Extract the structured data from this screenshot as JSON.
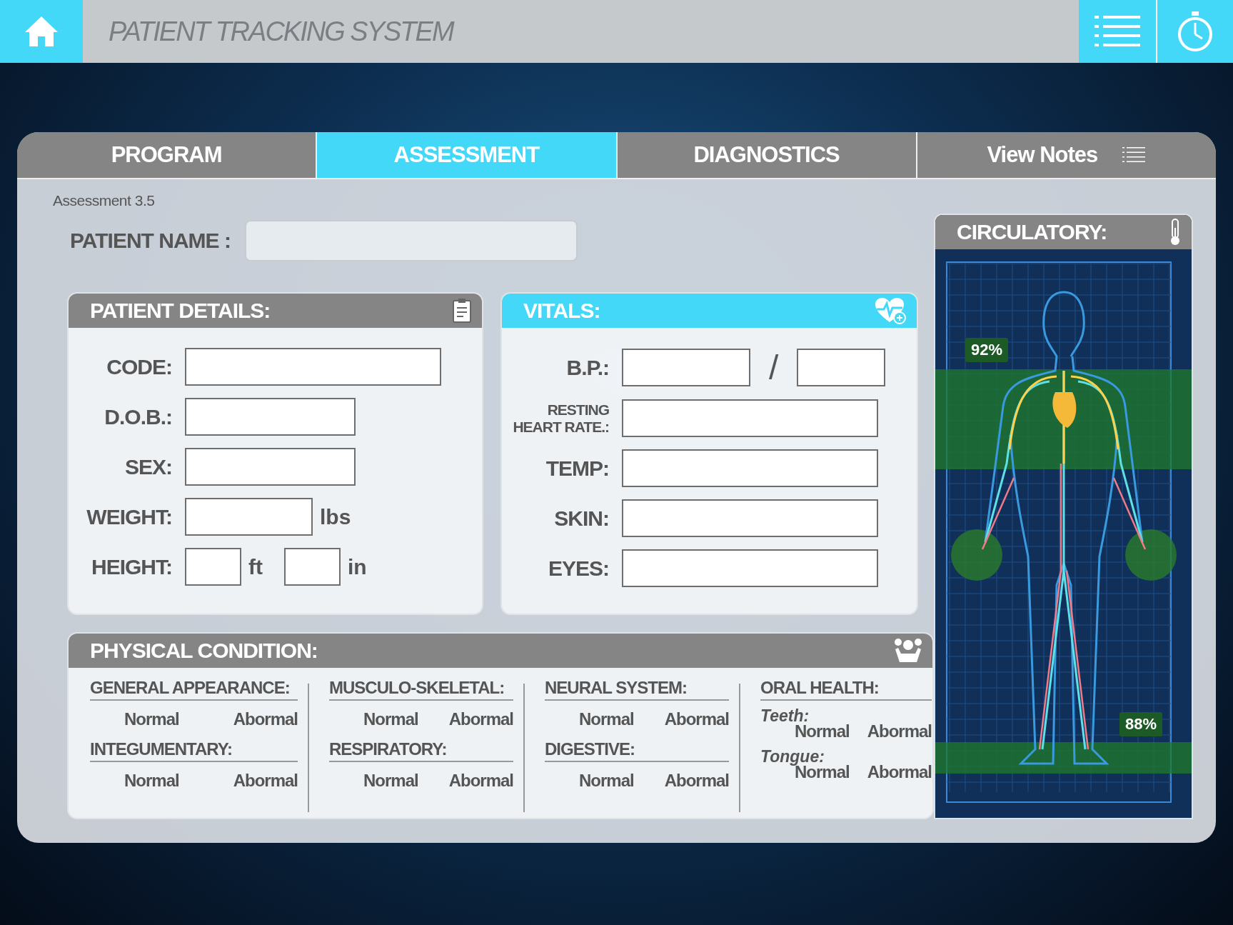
{
  "header": {
    "title": "PATIENT TRACKING SYSTEM"
  },
  "tabs": [
    {
      "label": "PROGRAM",
      "selected": false,
      "kind": "plain"
    },
    {
      "label": "ASSESSMENT",
      "selected": true,
      "kind": "plain"
    },
    {
      "label": "DIAGNOSTICS",
      "selected": false,
      "kind": "plain"
    },
    {
      "label": "View Notes",
      "selected": false,
      "kind": "notes"
    }
  ],
  "assessment_label": "Assessment 3.5",
  "patient_name": {
    "label": "PATIENT NAME :"
  },
  "patient_details": {
    "title": "PATIENT DETAILS:",
    "fields": [
      {
        "label": "CODE:",
        "kind": "long"
      },
      {
        "label": "D.O.B.:",
        "kind": "short"
      },
      {
        "label": "SEX:",
        "kind": "short"
      },
      {
        "label": "WEIGHT:",
        "kind": "unit",
        "units": [
          "lbs"
        ]
      },
      {
        "label": "HEIGHT:",
        "kind": "unit",
        "units": [
          "ft",
          "in"
        ]
      }
    ]
  },
  "vitals": {
    "title": "VITALS:",
    "fields": [
      {
        "label": "B.P.:",
        "kind": "pair",
        "separator": "/"
      },
      {
        "label": "RESTING HEART RATE.:",
        "kind": "single"
      },
      {
        "label": "TEMP:",
        "kind": "single"
      },
      {
        "label": "SKIN:",
        "kind": "single"
      },
      {
        "label": "EYES:",
        "kind": "single"
      }
    ]
  },
  "physical_condition": {
    "title": "PHYSICAL CONDITION:",
    "columns": [
      {
        "kind": "sections",
        "sections": [
          {
            "title": "GENERAL APPEARANCE:",
            "options": [
              "Normal",
              "Abormal"
            ]
          },
          {
            "title": "INTEGUMENTARY:",
            "options": [
              "Normal",
              "Abormal"
            ]
          }
        ]
      },
      {
        "kind": "sections",
        "sections": [
          {
            "title": "MUSCULO-SKELETAL:",
            "options": [
              "Normal",
              "Abormal"
            ]
          },
          {
            "title": "RESPIRATORY:",
            "options": [
              "Normal",
              "Abormal"
            ]
          }
        ]
      },
      {
        "kind": "sections",
        "sections": [
          {
            "title": "NEURAL SYSTEM:",
            "options": [
              "Normal",
              "Abormal"
            ]
          },
          {
            "title": "DIGESTIVE:",
            "options": [
              "Normal",
              "Abormal"
            ]
          }
        ]
      },
      {
        "kind": "subsections",
        "title": "ORAL HEALTH:",
        "subsections": [
          {
            "label": "Teeth:",
            "options": [
              "Normal",
              "Abormal"
            ]
          },
          {
            "label": "Tongue:",
            "options": [
              "Normal",
              "Abormal"
            ]
          }
        ]
      }
    ]
  },
  "circulatory": {
    "title": "CIRCULATORY:",
    "readings": [
      "92%",
      "88%"
    ]
  }
}
